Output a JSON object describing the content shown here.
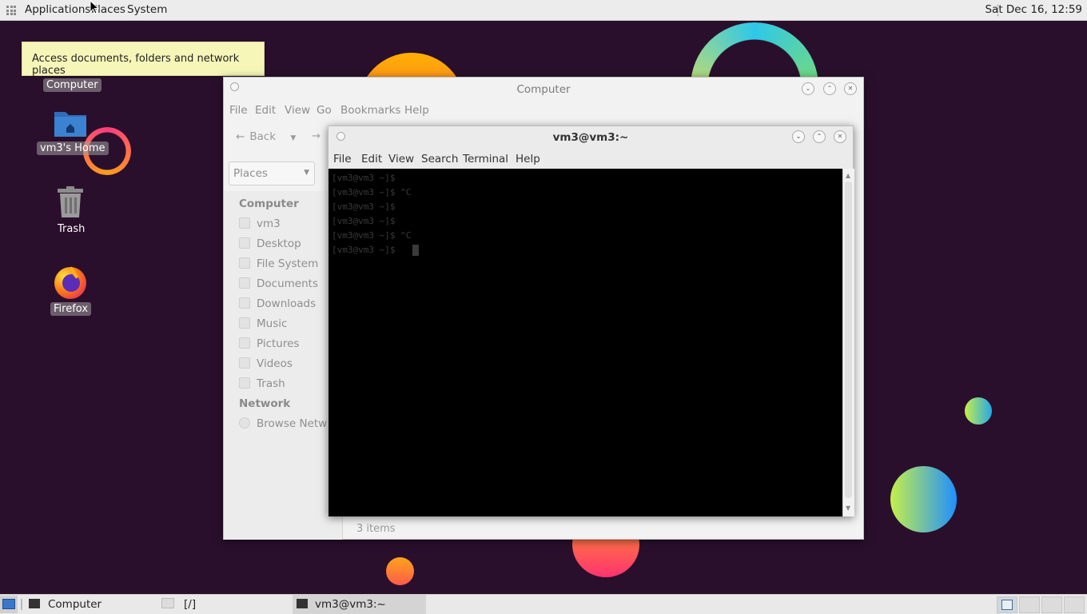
{
  "top_panel": {
    "menus": [
      "Applications",
      "Places",
      "System"
    ],
    "clock": "Sat Dec 16, 12:59"
  },
  "tooltip": "Access documents, folders and network places",
  "desktop_icons": [
    {
      "label": "Computer",
      "icon": "computer-icon"
    },
    {
      "label": "vm3's Home",
      "icon": "home-folder-icon"
    },
    {
      "label": "Trash",
      "icon": "trash-icon"
    },
    {
      "label": "Firefox",
      "icon": "firefox-icon"
    }
  ],
  "file_manager": {
    "title": "Computer",
    "menu": [
      "File",
      "Edit",
      "View",
      "Go",
      "Bookmarks",
      "Help"
    ],
    "back_label": "Back",
    "places_label": "Places",
    "sidebar": {
      "computer_heading": "Computer",
      "items": [
        "vm3",
        "Desktop",
        "File System",
        "Documents",
        "Downloads",
        "Music",
        "Pictures",
        "Videos",
        "Trash"
      ],
      "network_heading": "Network",
      "network_items": [
        "Browse Netw"
      ]
    },
    "status": "3 items"
  },
  "terminal": {
    "title": "vm3@vm3:~",
    "menu": [
      "File",
      "Edit",
      "View",
      "Search",
      "Terminal",
      "Help"
    ],
    "lines": [
      "[vm3@vm3 ~]$",
      "[vm3@vm3 ~]$ ^C",
      "[vm3@vm3 ~]$",
      "[vm3@vm3 ~]$",
      "[vm3@vm3 ~]$ ^C",
      "[vm3@vm3 ~]$"
    ]
  },
  "taskbar": {
    "tasks": [
      "Computer",
      "[/]",
      "vm3@vm3:~"
    ]
  },
  "colors": {
    "desktop_bg": "#2a0f2c",
    "tooltip_bg": "#f6f6b9",
    "terminal_bg": "#000000"
  }
}
